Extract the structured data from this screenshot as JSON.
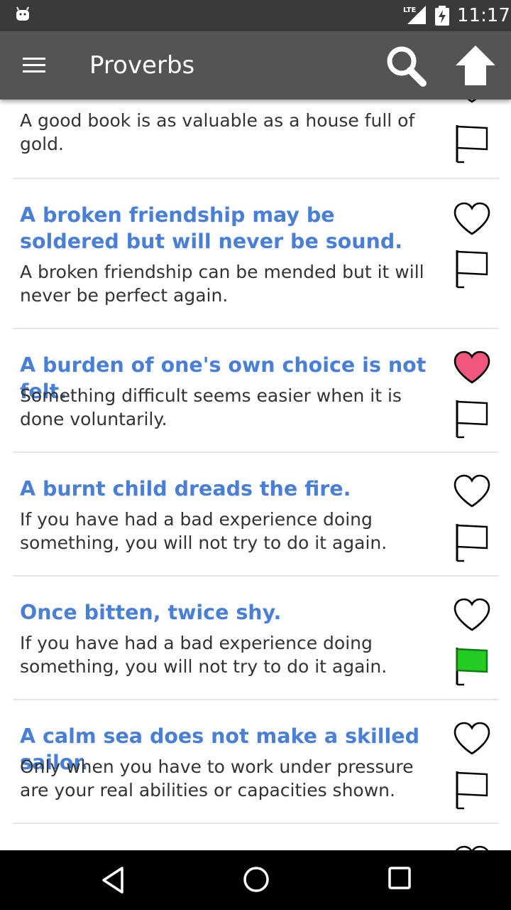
{
  "status_bar": {
    "time": "11:17",
    "network": "LTE",
    "icons": [
      "android-icon",
      "lte-signal-icon",
      "battery-charging-icon"
    ]
  },
  "app_bar": {
    "title": "Proverbs",
    "icons": [
      "menu-icon",
      "search-icon",
      "arrow-up-icon"
    ]
  },
  "colors": {
    "app_bar": "#545454",
    "status_bar": "#3a3a3a",
    "proverb_text": "#4a7fd6",
    "favorite_heart": "#f0567e",
    "flag_active": "#22cc22"
  },
  "items": [
    {
      "proverb": "",
      "meaning": "A good book is as valuable as a house full of gold.",
      "favorite": false,
      "flagged": false
    },
    {
      "proverb": "A broken friendship may be soldered but will never be sound.",
      "meaning": "A broken friendship can be mended but it will never be perfect again.",
      "favorite": false,
      "flagged": false
    },
    {
      "proverb": "A burden of one's own choice is not felt.",
      "meaning": "Something difficult seems easier when it is done voluntarily.",
      "favorite": true,
      "flagged": false
    },
    {
      "proverb": "A burnt child dreads the fire.",
      "meaning": "If you have had a bad experience doing something, you will not try to do it again.",
      "favorite": false,
      "flagged": false
    },
    {
      "proverb": "Once bitten, twice shy.",
      "meaning": "If you have had a bad experience doing something, you will not try to do it again.",
      "favorite": false,
      "flagged": true
    },
    {
      "proverb": "A calm sea does not make a skilled sailor.",
      "meaning": "Only when you have to work under pressure are your real abilities or capacities shown.",
      "favorite": false,
      "flagged": false
    }
  ],
  "nav_bar": {
    "icons": [
      "back-icon",
      "home-icon",
      "recents-icon"
    ]
  }
}
